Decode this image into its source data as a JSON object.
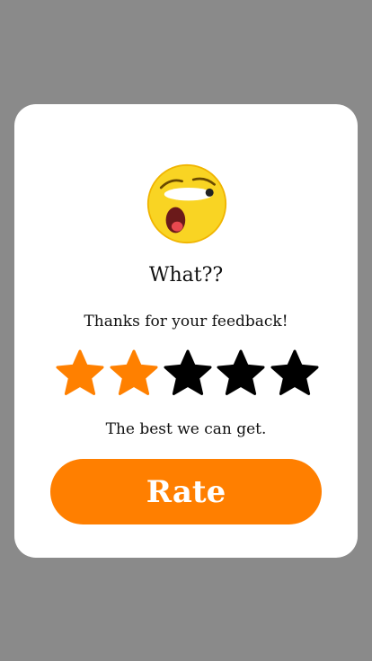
{
  "dialog": {
    "emoji_icon": "astonished-face-icon",
    "title": "What??",
    "message": "Thanks for your feedback!",
    "subtitle": "The best we can get.",
    "rate_button_label": "Rate"
  },
  "rating": {
    "value": 2,
    "max": 5,
    "filled_color": "#ff8000",
    "empty_color": "#000000"
  },
  "colors": {
    "accent": "#ff7f00",
    "backdrop": "#8a8a8a",
    "card": "#ffffff"
  }
}
